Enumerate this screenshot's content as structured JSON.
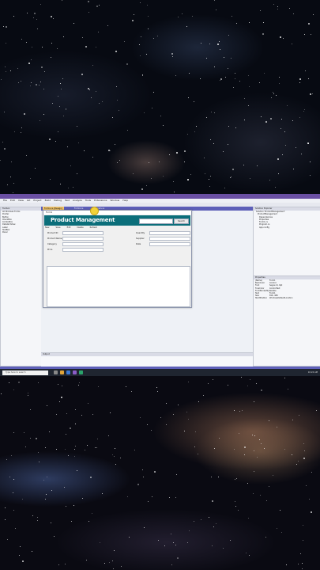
{
  "ide": {
    "title": "ProductManagement - Microsoft Visual Studio",
    "menu": [
      "File",
      "Edit",
      "View",
      "Git",
      "Project",
      "Build",
      "Debug",
      "Test",
      "Analyze",
      "Tools",
      "Extensions",
      "Window",
      "Help"
    ],
    "tabs": [
      "Form1.cs [Design]",
      "Form1.cs",
      "Program.cs"
    ],
    "solution_explorer_title": "Solution Explorer",
    "solution_items": [
      "Solution 'ProductManagement'",
      "ProductManagement",
      "Dependencies",
      "Properties",
      "Form1.cs",
      "Program.cs",
      "App.config"
    ],
    "left_items": [
      "Toolbox",
      "All Windows Forms",
      "Pointer",
      "Button",
      "CheckBox",
      "ComboBox",
      "DataGridView",
      "Label",
      "TextBox",
      "Panel"
    ],
    "properties_title": "Properties",
    "properties": [
      [
        "(Name)",
        "Form1"
      ],
      [
        "BackColor",
        "Control"
      ],
      [
        "Font",
        "Segoe UI, 9pt"
      ],
      [
        "ForeColor",
        "ControlText"
      ],
      [
        "FormBorderStyle",
        "Sizable"
      ],
      [
        "Text",
        "Form1"
      ],
      [
        "Size",
        "816, 489"
      ],
      [
        "StartPosition",
        "WindowsDefaultLocation"
      ]
    ],
    "output_title": "Output"
  },
  "form": {
    "caption": "Form1",
    "title": "Product Management",
    "search_button": "Search",
    "actions": [
      "New",
      "Save",
      "Edit",
      "Delete",
      "Refresh"
    ],
    "left_labels": [
      "Product ID",
      "Product Name",
      "Category",
      "Price"
    ],
    "right_labels": [
      "Quantity",
      "Supplier",
      "Date"
    ]
  },
  "taskbar": {
    "search_placeholder": "Type here to search",
    "tray_time": "10:24 AM"
  },
  "colors": {
    "form_banner": "#0b6e7a",
    "ide_accent": "#5d5fb8",
    "active_tab": "#f3c66b"
  }
}
